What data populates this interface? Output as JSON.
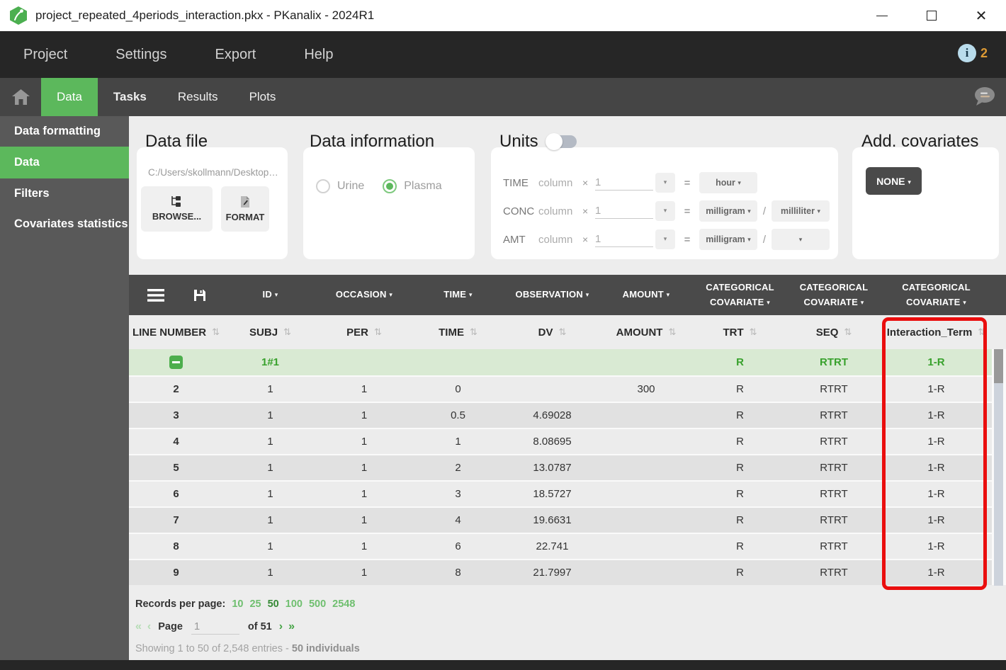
{
  "window": {
    "title": "project_repeated_4periods_interaction.pkx - PKanalix - 2024R1",
    "controls": {
      "minimize": "minimize",
      "maximize": "maximize",
      "close": "close"
    }
  },
  "menu": {
    "items": [
      "Project",
      "Settings",
      "Export",
      "Help"
    ],
    "notification_count": "2"
  },
  "tabs": {
    "items": [
      "Data",
      "Tasks",
      "Results",
      "Plots"
    ],
    "active": "Data"
  },
  "sidebar": {
    "items": [
      "Data formatting",
      "Data",
      "Filters",
      "Covariates statistics"
    ],
    "active": "Data"
  },
  "panels": {
    "data_file": {
      "title": "Data file",
      "path": "C:/Users/skollmann/Desktop…",
      "browse_label": "BROWSE...",
      "format_label": "FORMAT"
    },
    "data_information": {
      "title": "Data information",
      "options": [
        {
          "label": "Urine",
          "selected": false
        },
        {
          "label": "Plasma",
          "selected": true
        }
      ]
    },
    "units": {
      "title": "Units",
      "toggle_on": false,
      "rows": [
        {
          "label": "TIME",
          "column": "column",
          "mult": "×",
          "value": "1",
          "unit1": "hour",
          "slash": "",
          "unit2": ""
        },
        {
          "label": "CONC",
          "column": "column",
          "mult": "×",
          "value": "1",
          "unit1": "milligram",
          "slash": "/",
          "unit2": "milliliter"
        },
        {
          "label": "AMT",
          "column": "column",
          "mult": "×",
          "value": "1",
          "unit1": "milligram",
          "slash": "/",
          "unit2": ""
        }
      ]
    },
    "covariates": {
      "title": "Add. covariates",
      "button_label": "NONE"
    }
  },
  "table": {
    "type_headers": [
      "ID",
      "OCCASION",
      "TIME",
      "OBSERVATION",
      "AMOUNT",
      "CATEGORICAL COVARIATE",
      "CATEGORICAL COVARIATE",
      "CATEGORICAL COVARIATE"
    ],
    "column_headers": [
      "LINE NUMBER",
      "SUBJ",
      "PER",
      "TIME",
      "DV",
      "AMOUNT",
      "TRT",
      "SEQ",
      "Interaction_Term"
    ],
    "group_row": {
      "subj": "1#1",
      "trt": "R",
      "seq": "RTRT",
      "interaction": "1-R"
    },
    "row_fields": [
      "line",
      "subj",
      "per",
      "time",
      "dv",
      "amount",
      "trt",
      "seq",
      "interaction"
    ],
    "rows": [
      {
        "line": "2",
        "subj": "1",
        "per": "1",
        "time": "0",
        "dv": "",
        "amount": "300",
        "trt": "R",
        "seq": "RTRT",
        "interaction": "1-R"
      },
      {
        "line": "3",
        "subj": "1",
        "per": "1",
        "time": "0.5",
        "dv": "4.69028",
        "amount": "",
        "trt": "R",
        "seq": "RTRT",
        "interaction": "1-R"
      },
      {
        "line": "4",
        "subj": "1",
        "per": "1",
        "time": "1",
        "dv": "8.08695",
        "amount": "",
        "trt": "R",
        "seq": "RTRT",
        "interaction": "1-R"
      },
      {
        "line": "5",
        "subj": "1",
        "per": "1",
        "time": "2",
        "dv": "13.0787",
        "amount": "",
        "trt": "R",
        "seq": "RTRT",
        "interaction": "1-R"
      },
      {
        "line": "6",
        "subj": "1",
        "per": "1",
        "time": "3",
        "dv": "18.5727",
        "amount": "",
        "trt": "R",
        "seq": "RTRT",
        "interaction": "1-R"
      },
      {
        "line": "7",
        "subj": "1",
        "per": "1",
        "time": "4",
        "dv": "19.6631",
        "amount": "",
        "trt": "R",
        "seq": "RTRT",
        "interaction": "1-R"
      },
      {
        "line": "8",
        "subj": "1",
        "per": "1",
        "time": "6",
        "dv": "22.741",
        "amount": "",
        "trt": "R",
        "seq": "RTRT",
        "interaction": "1-R"
      },
      {
        "line": "9",
        "subj": "1",
        "per": "1",
        "time": "8",
        "dv": "21.7997",
        "amount": "",
        "trt": "R",
        "seq": "RTRT",
        "interaction": "1-R"
      }
    ],
    "highlighted_column": "Interaction_Term"
  },
  "footer": {
    "records_label": "Records per page:",
    "options": [
      "10",
      "25",
      "50",
      "100",
      "500",
      "2548"
    ],
    "selected_option": "50",
    "page_label": "Page",
    "page_value": "1",
    "of_label": "of 51",
    "showing_text": "Showing 1 to 50 of 2,548 entries - ",
    "individuals_text": "50 individuals"
  },
  "colors": {
    "accent_green": "#5cb85c",
    "group_row_bg": "#d9ead3",
    "group_row_text": "#38a12c",
    "highlight_red": "#ea0e0e",
    "header_dark": "#4a4a4a",
    "sidebar_gray": "#595959",
    "menubar_dark": "#262626",
    "notification_orange": "#dd9a34"
  }
}
